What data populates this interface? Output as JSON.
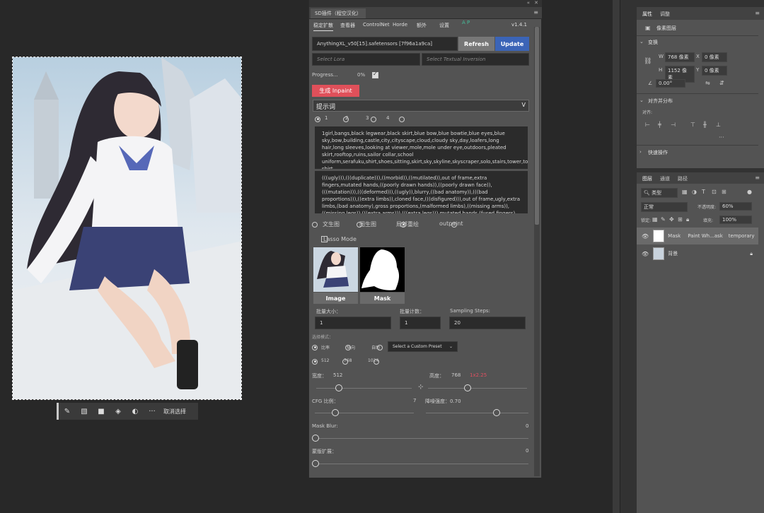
{
  "canvas": {
    "toolbar_icons": [
      "brush-icon",
      "mask-subtract-icon",
      "mask-icon",
      "fill-icon",
      "adjust-icon",
      "more-icon"
    ],
    "toolbar_glyphs": [
      "✎",
      "▧",
      "■",
      "◈",
      "◐",
      "···"
    ],
    "deselect_label": "取消选择"
  },
  "sd": {
    "tab_title": "SD插件（程空汉化）",
    "nav": [
      "稳定扩散",
      "查看器",
      "ControlNet",
      "Horde",
      "额外",
      "设置"
    ],
    "nav_ap": "A P",
    "version": "v1.4.1",
    "model": "AnythingXL_v50[15].safetensors [7f96a1a9ca]",
    "refresh": "Refresh",
    "update": "Update",
    "lora_placeholder": "Select Lora",
    "ti_placeholder": "Select Textual Inversion",
    "progress_label": "Progress...",
    "progress_value": "0%",
    "generate": "生成 Inpaint",
    "prompt_header": "提示词",
    "prompt_collapse": "V",
    "prompt_tabs": [
      "1",
      "2",
      "3",
      "4"
    ],
    "positive_prompt": "1girl,bangs,black legwear,black skirt,blue bow,blue bowtie,blue eyes,blue sky,bow,building,castle,city,cityscape,cloud,cloudy sky,day,loafers,long hair,long sleeves,looking at viewer,mole,mole under eye,outdoors,pleated skirt,rooftop,ruins,sailor collar,school uniform,serafuku,shirt,shoes,sitting,skirt,sky,skyline,skyscraper,solo,stairs,tower,town,white shirt,",
    "negative_prompt": "(((ugly))),(((duplicate))),((morbid)),((mutilated)),out of frame,extra fingers,mutated hands,((poorly drawn hands)),((poorly drawn face)),(((mutation))),(((deformed))),((ugly)),blurry,((bad anatomy)),(((bad proportions))),((extra limbs)),cloned face,(((disfigured))),out of frame,ugly,extra limbs,(bad anatomy),gross proportions,(malformed limbs),((missing arms)),((missing legs)),(((extra arms))),(((extra legs))),mutated hands,(fused fingers),(too",
    "modes": [
      "文生图",
      "图生图",
      "局部重绘",
      "outpaint"
    ],
    "lasso": "Lasso Mode",
    "image_label": "Image",
    "mask_label": "Mask",
    "batch_size_label": "批量大小：",
    "batch_count_label": "批量计数：",
    "steps_label": "Sampling Steps:",
    "batch_size": "1",
    "batch_count": "1",
    "steps": "20",
    "scale_label": "选择模式：",
    "ratio_options": [
      "比率",
      "纵向",
      "自助"
    ],
    "preset": "Select a Custom Preset",
    "size_options": [
      "512",
      "768",
      "1024"
    ],
    "width_label": "宽度：",
    "width": "512",
    "height_label": "高度：",
    "height": "768",
    "ratio_val": "1x2.25",
    "cfg_label": "CFG 比例：",
    "cfg": "7",
    "denoise_label": "降噪强度：0.70",
    "mask_blur_label": "Mask Blur:",
    "mask_blur": "0",
    "mask_expand_label": "蒙版扩展：",
    "mask_expand": "0"
  },
  "props": {
    "tabs": [
      "属性",
      "调整"
    ],
    "pixel_layer": "像素图层",
    "transform": "变换",
    "w_label": "W",
    "w": "768 像素",
    "x_label": "X",
    "x": "0 像素",
    "h_label": "H",
    "h": "1152 像素",
    "y_label": "Y",
    "y": "0 像素",
    "angle": "0.00°",
    "align": "对齐并分布",
    "align_sub": "对齐:",
    "more": "···",
    "quick": "快速操作",
    "layer_tabs": [
      "图层",
      "通道",
      "路径"
    ],
    "kind": "类型",
    "blend": "正常",
    "opacity_label": "不透明度:",
    "opacity": "60%",
    "lock_label": "锁定:",
    "fill_label": "填充:",
    "fill": "100%",
    "layers": [
      {
        "name": "Mask",
        "extra": "Paint Wh...ask",
        "tag": "temporary"
      },
      {
        "name": "背景",
        "extra": "",
        "tag": ""
      }
    ]
  }
}
